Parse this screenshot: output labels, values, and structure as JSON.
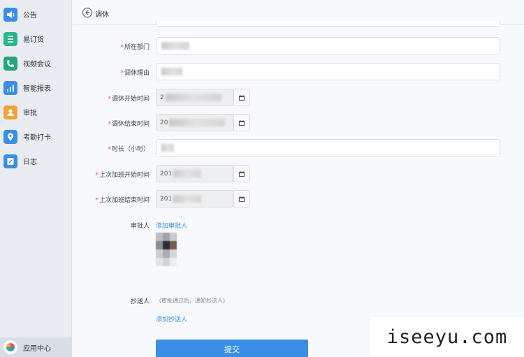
{
  "sidebar": {
    "items": [
      {
        "label": "公告",
        "icon": "megaphone-icon",
        "color": "#3a8ee6"
      },
      {
        "label": "易订货",
        "icon": "order-icon",
        "color": "#2bb58a"
      },
      {
        "label": "视频会议",
        "icon": "phone-icon",
        "color": "#22a87a"
      },
      {
        "label": "智能报表",
        "icon": "chart-icon",
        "color": "#3a8ee6"
      },
      {
        "label": "审批",
        "icon": "person-icon",
        "color": "#f2a23b"
      },
      {
        "label": "考勤打卡",
        "icon": "location-icon",
        "color": "#3a8ee6"
      },
      {
        "label": "日志",
        "icon": "note-icon",
        "color": "#3a8ee6"
      }
    ],
    "app_center": {
      "label": "应用中心",
      "icon": "app-center-icon"
    }
  },
  "header": {
    "title": "调休"
  },
  "form": {
    "required_mark": "*",
    "department": {
      "label": "所在部门"
    },
    "reason": {
      "label": "调休理由"
    },
    "start_time": {
      "label": "调休开始时间",
      "value": "2"
    },
    "end_time": {
      "label": "调休结束时间",
      "value": "20"
    },
    "duration": {
      "label": "时长（小时）"
    },
    "last_ot_start": {
      "label": "上次加班开始时间",
      "value": "201"
    },
    "last_ot_end": {
      "label": "上次加班结束时间",
      "value": "201"
    },
    "approver": {
      "label": "审批人",
      "add_link": "添加审批人"
    },
    "cc": {
      "label": "抄送人",
      "hint": "（审批通过后，通知抄送人）",
      "add_link": "添加抄送人"
    },
    "submit_label": "提交"
  },
  "watermark": "iseeyu.com",
  "colors": {
    "accent": "#3a8ee6",
    "required": "#e8505b",
    "sidebar_bg": "#e9edf2"
  }
}
